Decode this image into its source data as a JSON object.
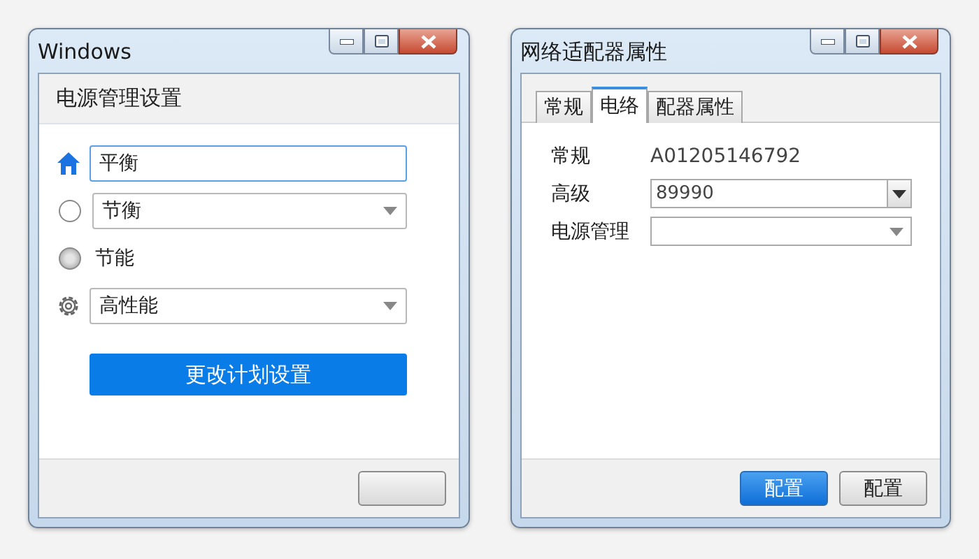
{
  "power_window": {
    "title": "Windows",
    "header": "电源管理设置",
    "rows": [
      {
        "kind": "input",
        "value": "平衡",
        "focused": true
      },
      {
        "kind": "select",
        "checked": false,
        "value": "节衡"
      },
      {
        "kind": "label",
        "checked": true,
        "text": "节能"
      },
      {
        "kind": "select",
        "value": "高性能"
      }
    ],
    "action_button": "更改计划设置",
    "footer_buttons": [
      {
        "primary": false
      }
    ]
  },
  "adapter_window": {
    "title": "网络适配器属性",
    "tabs": [
      {
        "label": "常规",
        "selected": false
      },
      {
        "label": "电络",
        "selected": true
      },
      {
        "label": "配器属性",
        "selected": false
      }
    ],
    "fields": [
      {
        "kind": "text",
        "label": "常规",
        "value": "A01205146792"
      },
      {
        "kind": "combo",
        "label": "高级",
        "value": "89990"
      },
      {
        "kind": "dropdown",
        "label": "电源管理"
      }
    ],
    "footer_buttons": [
      {
        "label": "配置",
        "primary": true
      },
      {
        "label": "配置",
        "primary": false
      }
    ]
  }
}
